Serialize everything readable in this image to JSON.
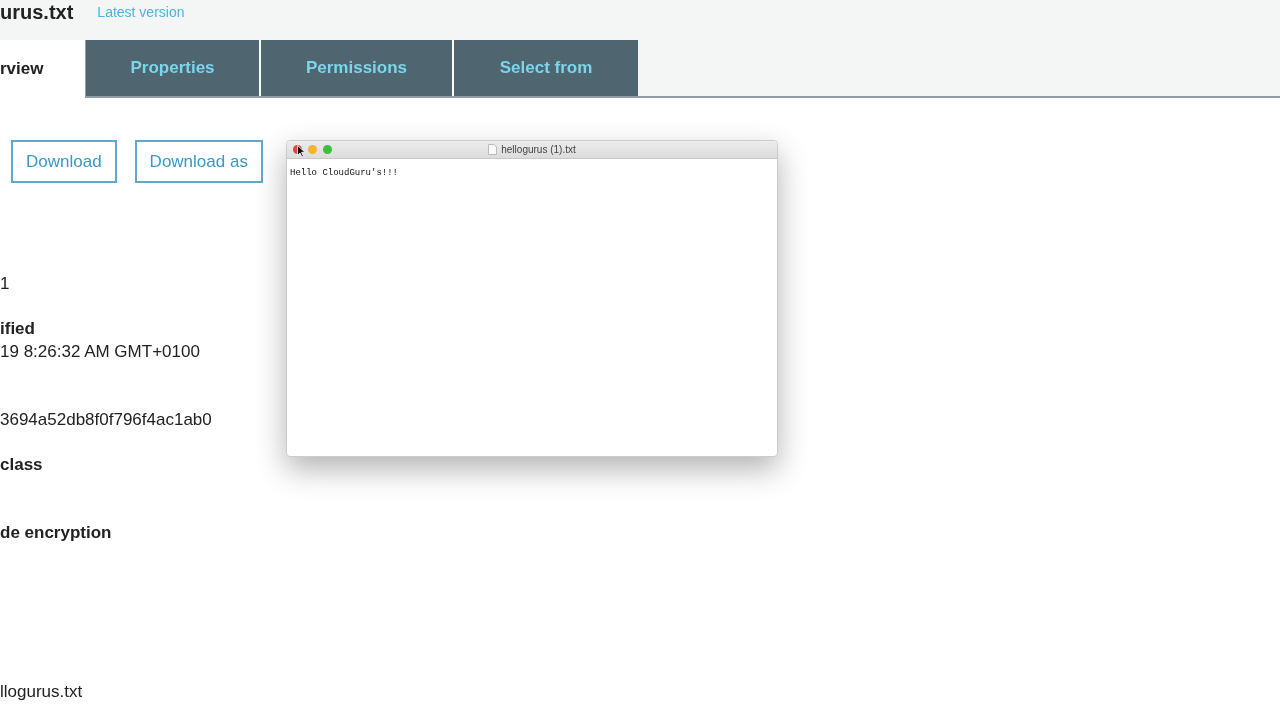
{
  "header": {
    "title": "urus.txt",
    "version_link": "Latest version"
  },
  "tabs": [
    {
      "label": "rview",
      "selected": true
    },
    {
      "label": "Properties",
      "selected": false
    },
    {
      "label": "Permissions",
      "selected": false
    },
    {
      "label": "Select from",
      "selected": false
    }
  ],
  "buttons": [
    "Download",
    "Download as"
  ],
  "fields": [
    {
      "value": "1"
    },
    {
      "label": "ified",
      "value": "19 8:26:32 AM GMT+0100"
    },
    {
      "value": "3694a52db8f0f796f4ac1ab0"
    },
    {
      "label": "class"
    },
    {
      "label": "de encryption"
    },
    {
      "value": "llogurus.txt"
    }
  ],
  "text_window": {
    "title": "hellogurus (1).txt",
    "content": "Hello CloudGuru's!!!"
  }
}
